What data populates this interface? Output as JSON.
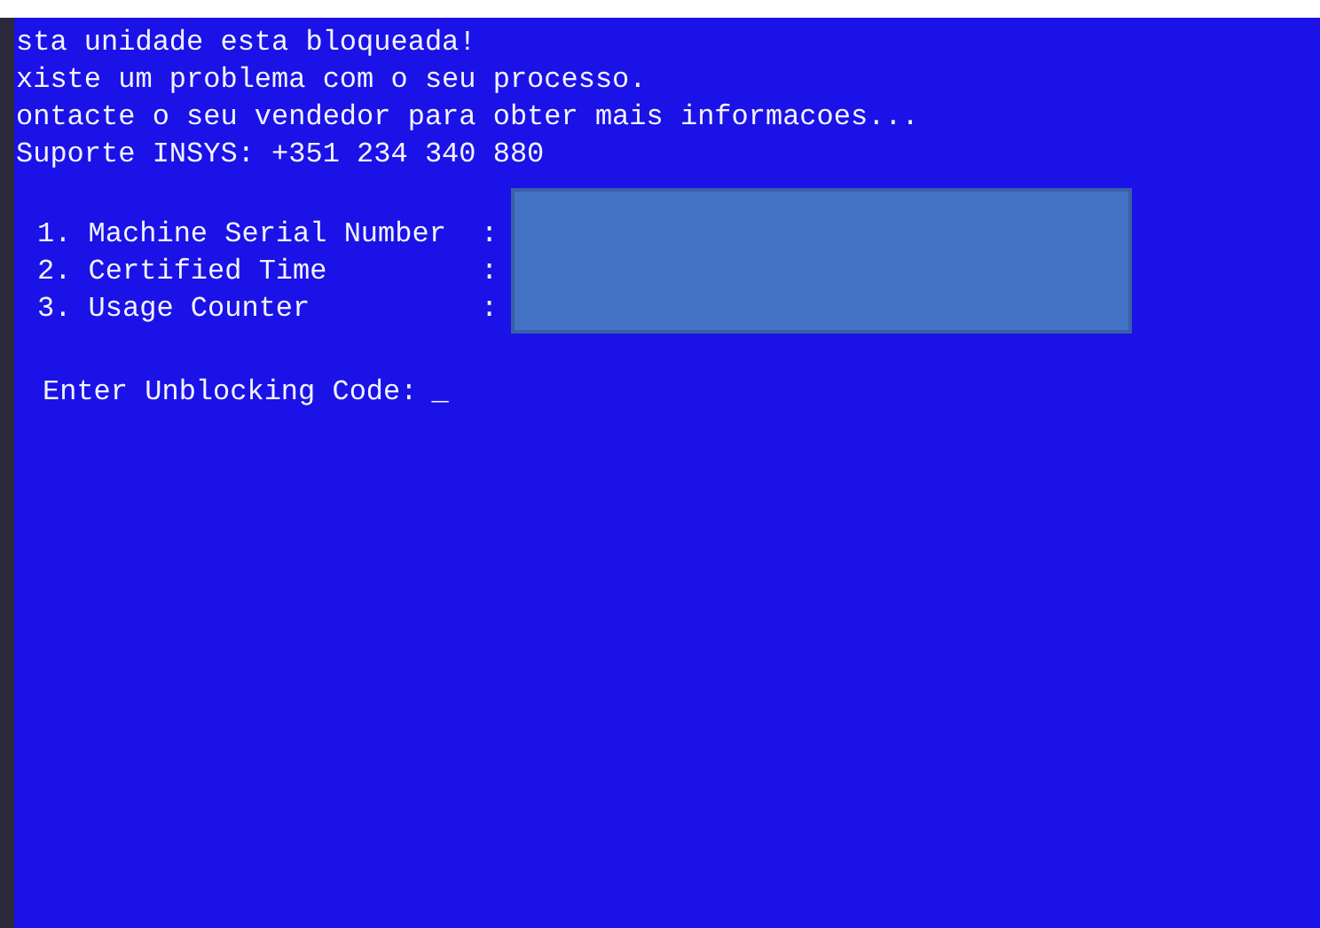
{
  "messages": [
    "sta unidade esta bloqueada!",
    "xiste um problema com o seu processo.",
    "ontacte o seu vendedor para obter mais informacoes...",
    "Suporte INSYS: +351 234 340 880"
  ],
  "fields": [
    {
      "label": "1. Machine Serial Number",
      "separator": ":"
    },
    {
      "label": "2. Certified Time",
      "separator": ":"
    },
    {
      "label": "3. Usage Counter",
      "separator": ":"
    }
  ],
  "prompt": {
    "label": "Enter Unblocking Code:",
    "cursor": "_"
  }
}
